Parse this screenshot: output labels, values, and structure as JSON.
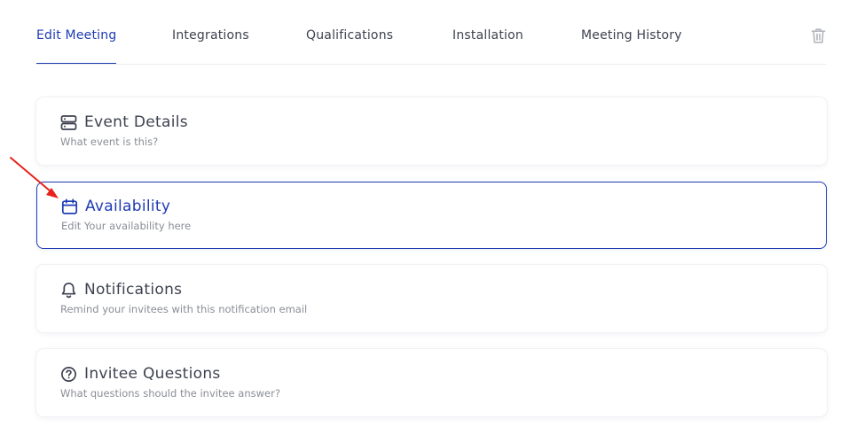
{
  "tabs": [
    {
      "label": "Edit Meeting",
      "active": true
    },
    {
      "label": "Integrations",
      "active": false
    },
    {
      "label": "Qualifications",
      "active": false
    },
    {
      "label": "Installation",
      "active": false
    },
    {
      "label": "Meeting History",
      "active": false
    }
  ],
  "sections": [
    {
      "title": "Event Details",
      "subtitle": "What event is this?",
      "icon": "server-icon",
      "selected": false
    },
    {
      "title": "Availability",
      "subtitle": "Edit Your availability here",
      "icon": "calendar-icon",
      "selected": true
    },
    {
      "title": "Notifications",
      "subtitle": "Remind your invitees with this notification email",
      "icon": "bell-icon",
      "selected": false
    },
    {
      "title": "Invitee Questions",
      "subtitle": "What questions should the invitee answer?",
      "icon": "question-circle-icon",
      "selected": false
    }
  ],
  "colors": {
    "accent": "#1f3bb3",
    "text": "#3e4250",
    "muted": "#8a8d96",
    "annotation_arrow": "#e8201e"
  }
}
